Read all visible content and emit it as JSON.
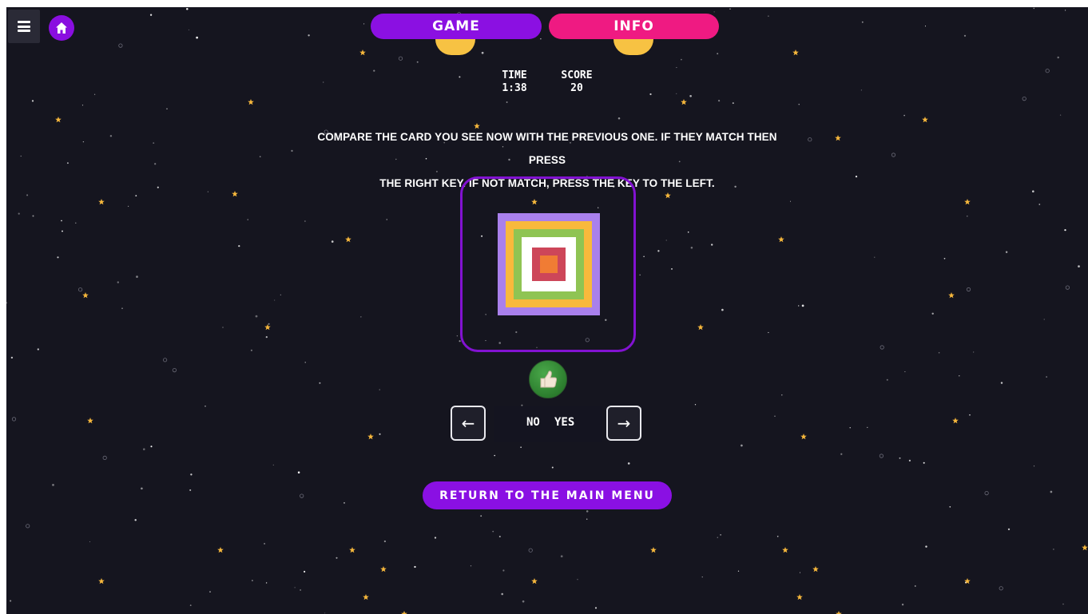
{
  "header": {
    "tabs": [
      {
        "label": "GAME",
        "color": "#8b10e2"
      },
      {
        "label": "INFO",
        "color": "#ef1a82"
      }
    ]
  },
  "stats": {
    "time_label": "TIME",
    "time_value": "1:38",
    "score_label": "SCORE",
    "score_value": "20"
  },
  "instructions": {
    "line1": "COMPARE THE CARD YOU SEE NOW WITH THE PREVIOUS ONE. IF THEY MATCH THEN PRESS",
    "line2": "THE RIGHT KEY. IF NOT MATCH, PRESS THE KEY TO THE LEFT."
  },
  "card": {
    "border_color": "#8212d1",
    "square_colors": [
      "#a980ec",
      "#f8b93c",
      "#8fc453",
      "#ffffff",
      "#cd4659",
      "#f07c34"
    ]
  },
  "feedback": {
    "icon": "thumbs-up-icon",
    "result": "correct"
  },
  "controls": {
    "left_key_icon": "arrow-left-icon",
    "right_key_icon": "arrow-right-icon",
    "no_label": "NO",
    "yes_label": "YES"
  },
  "return_button": {
    "label": "RETURN TO THE MAIN MENU"
  },
  "icons": {
    "menu": "hamburger-menu-icon",
    "home": "home-icon"
  },
  "theme": {
    "background": "#15151f",
    "star_color": "#f6b73c",
    "accent": "#8a10e3"
  }
}
